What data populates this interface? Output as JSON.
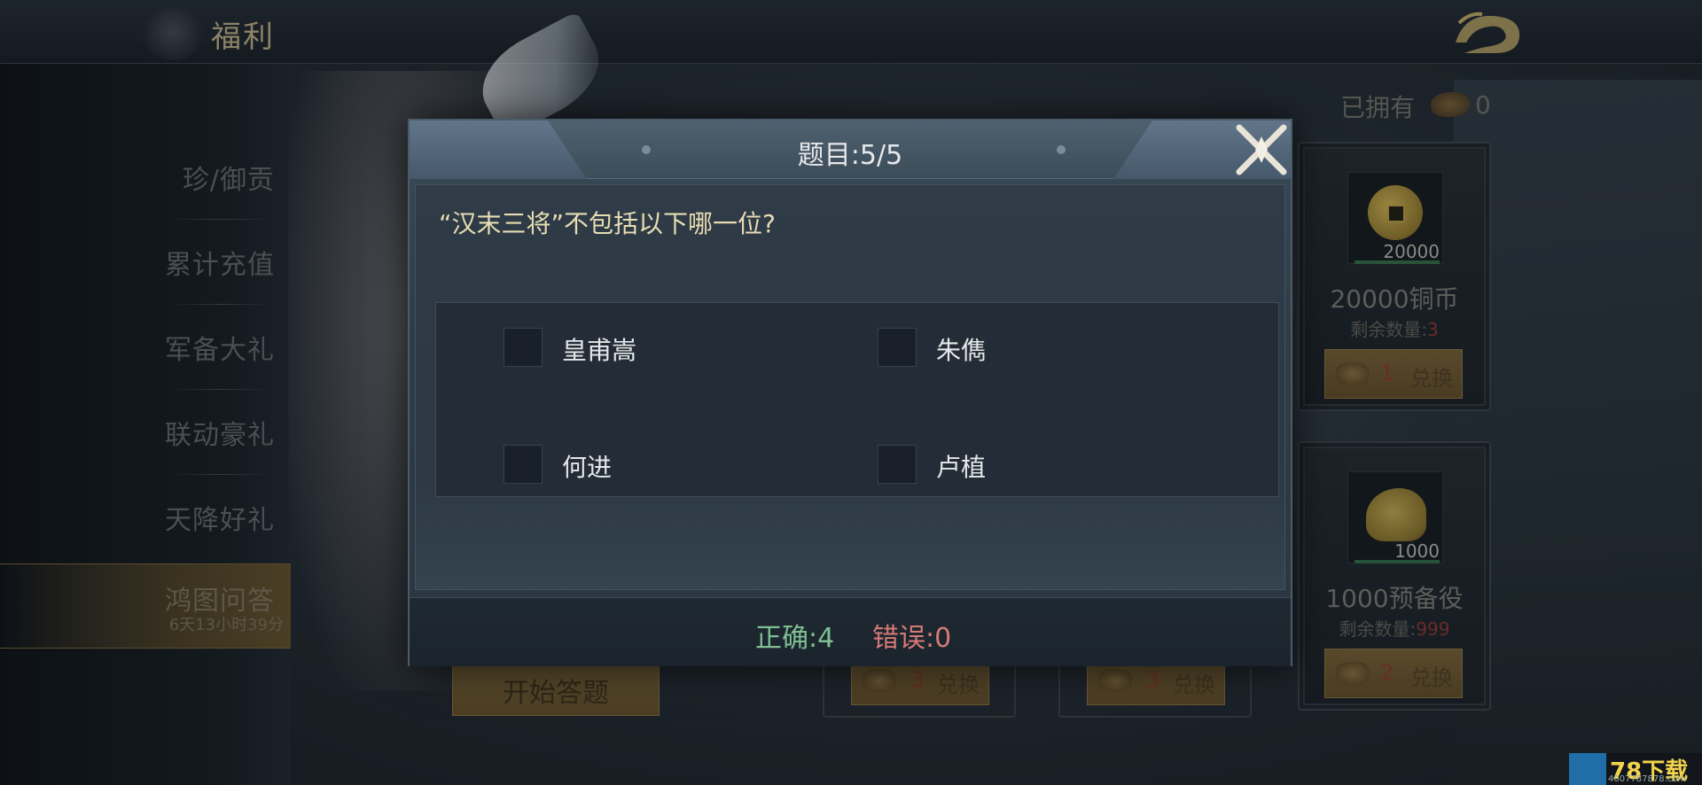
{
  "topbar": {
    "title": "福利"
  },
  "sidebar": {
    "items": [
      {
        "label": "珍/御贡"
      },
      {
        "label": "累计充值"
      },
      {
        "label": "军备大礼"
      },
      {
        "label": "联动豪礼"
      },
      {
        "label": "天降好礼"
      },
      {
        "label": "鸿图问答",
        "timer": "6天13小时39分",
        "active": true
      }
    ]
  },
  "shop": {
    "owned_label": "已拥有",
    "owned_value": "0",
    "owned_icon": "ticket-icon",
    "items": [
      {
        "amount": "20000",
        "name": "20000铜币",
        "remain_label": "剩余数量:",
        "remain_value": "3",
        "cost": "1",
        "exchange_label": "兑换",
        "icon": "copper-coin-icon"
      },
      {
        "amount": "1000",
        "name": "1000预备役",
        "remain_label": "剩余数量:",
        "remain_value": "999",
        "cost": "2",
        "exchange_label": "兑换",
        "icon": "reserve-helmet-icon"
      }
    ],
    "hidden_exchange": [
      {
        "cost": "3",
        "exchange_label": "兑换"
      },
      {
        "cost": "3",
        "exchange_label": "兑换"
      }
    ],
    "start_label": "开始答题"
  },
  "quiz": {
    "title": "题目:5/5",
    "question": "“汉末三将”不包括以下哪一位?",
    "options": [
      {
        "label": "皇甫嵩"
      },
      {
        "label": "朱儁"
      },
      {
        "label": "何进"
      },
      {
        "label": "卢植"
      }
    ],
    "correct": "正确:4",
    "wrong": "错误:0"
  },
  "watermark": {
    "brand": "78下载",
    "url": "4007787878.com"
  },
  "colors": {
    "correct": "#7fbf93",
    "wrong": "#d67a78",
    "question": "#e7ddb2",
    "modal_bg": "#2f3c48"
  }
}
